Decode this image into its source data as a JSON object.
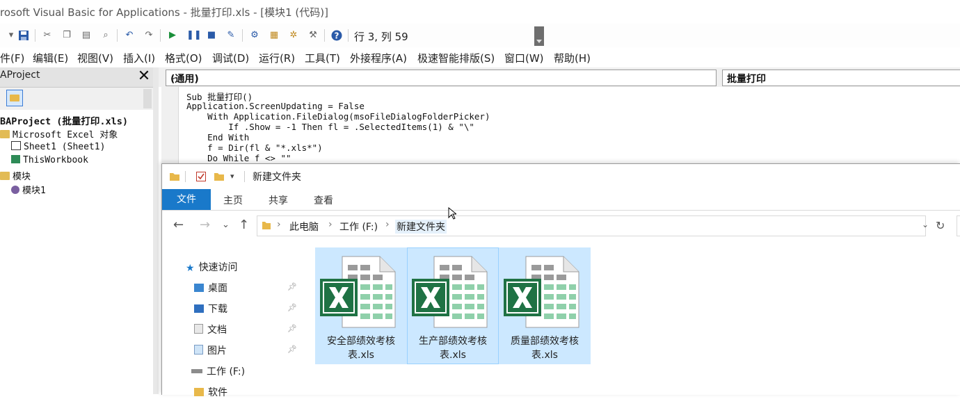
{
  "titlebar": {
    "title": "rosoft Visual Basic for Applications - 批量打印.xls - [模块1 (代码)]"
  },
  "toolbar": {
    "position_readout": "行 3, 列 59"
  },
  "menubar": {
    "items": [
      "件(F)",
      "编辑(E)",
      "视图(V)",
      "插入(I)",
      "格式(O)",
      "调试(D)",
      "运行(R)",
      "工具(T)",
      "外接程序(A)",
      "极速智能排版(S)",
      "窗口(W)",
      "帮助(H)"
    ]
  },
  "project": {
    "title": "AProject",
    "tree": {
      "root": "BAProject (批量打印.xls)",
      "excel_objects": "Microsoft Excel 对象",
      "sheet1": "Sheet1 (Sheet1)",
      "workbook": "ThisWorkbook",
      "modules": "模块",
      "module1": "模块1"
    }
  },
  "code": {
    "object_combo": "(通用)",
    "proc_combo": "批量打印",
    "lines": [
      "Sub 批量打印()",
      "Application.ScreenUpdating = False",
      "    With Application.FileDialog(msoFileDialogFolderPicker)",
      "        If .Show = -1 Then fl = .SelectedItems(1) & \"\\\"",
      "    End With",
      "    f = Dir(fl & \"*.xls*\")",
      "    Do While f <> \"\""
    ]
  },
  "explorer": {
    "title": "新建文件夹",
    "ribbon_tabs": [
      "文件",
      "主页",
      "共享",
      "查看"
    ],
    "breadcrumb": [
      "此电脑",
      "工作 (F:)",
      "新建文件夹"
    ],
    "nav": {
      "quick_access": "快速访问",
      "desktop": "桌面",
      "downloads": "下载",
      "documents": "文档",
      "pictures": "图片",
      "drive_f": "工作 (F:)",
      "software": "软件"
    },
    "files": [
      {
        "name": "安全部绩效考核表.xls"
      },
      {
        "name": "生产部绩效考核表.xls"
      },
      {
        "name": "质量部绩效考核表.xls"
      }
    ]
  },
  "colors": {
    "file_selected": "#cce8ff",
    "ribbon_file_tab": "#1979ca",
    "excel_green": "#1f7244"
  }
}
